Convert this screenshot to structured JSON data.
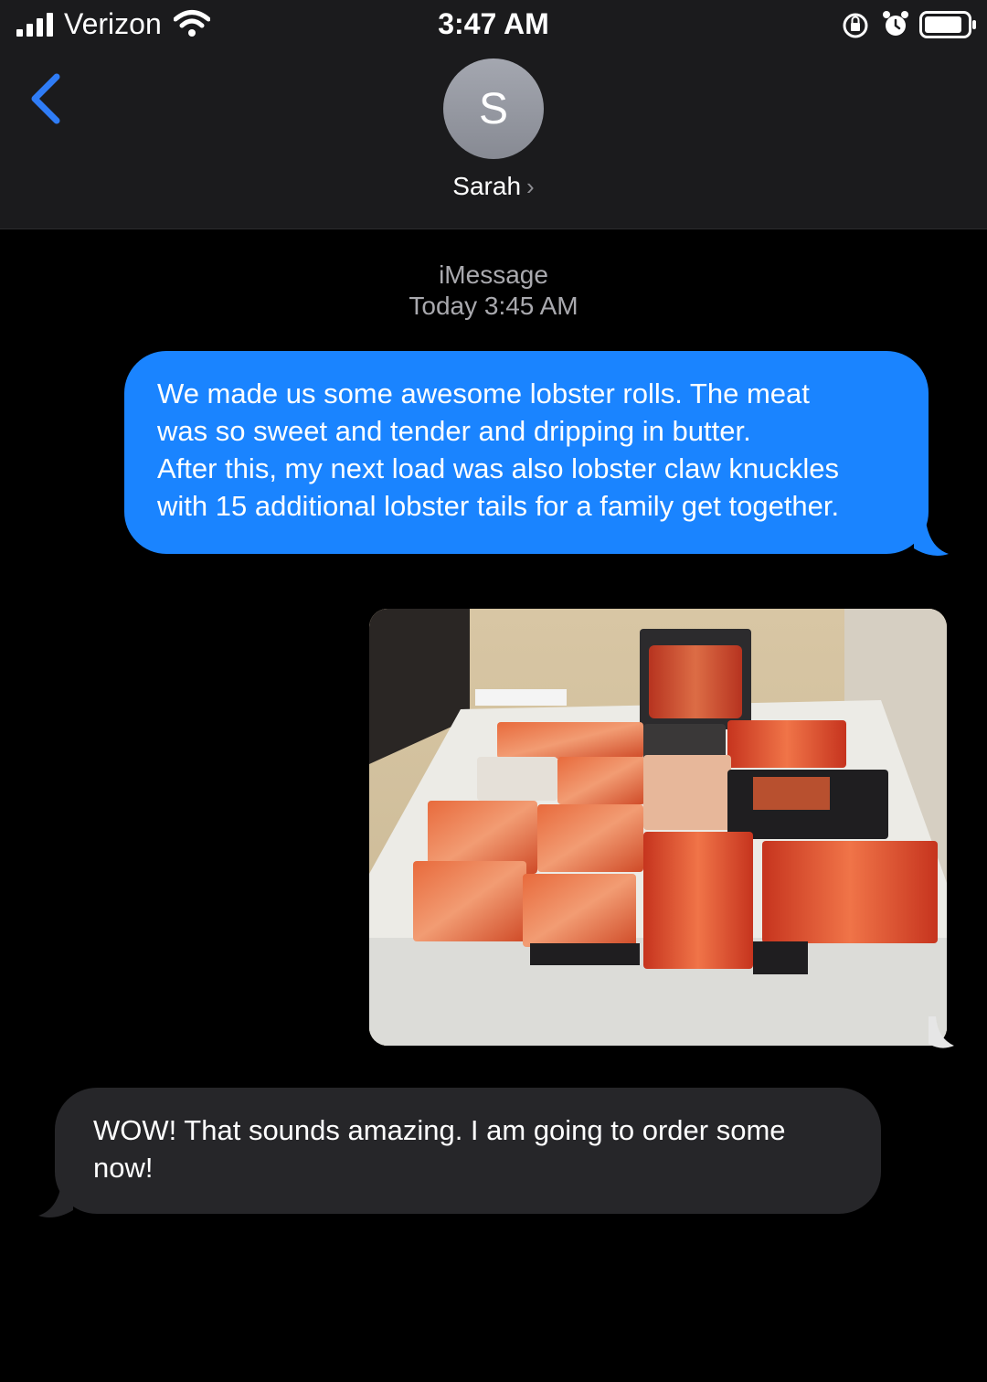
{
  "status_bar": {
    "carrier": "Verizon",
    "time": "3:47 AM"
  },
  "header": {
    "avatar_initial": "S",
    "contact_name": "Sarah",
    "chevron": "›"
  },
  "thread": {
    "service_label": "iMessage",
    "timestamp": "Today 3:45 AM"
  },
  "messages": [
    {
      "direction": "outgoing",
      "lines": [
        "We made us some awesome lobster rolls. The meat",
        "was so sweet and tender and dripping in butter.",
        "After this, my next load was also lobster claw knuckles",
        "with 15 additional lobster tails for a family get together."
      ]
    },
    {
      "direction": "outgoing",
      "attachment": "photo of packaged lobster meat on a freezer"
    },
    {
      "direction": "incoming",
      "lines": [
        "WOW! That sounds amazing. I am going to order some",
        "now!"
      ]
    }
  ],
  "colors": {
    "outgoing_bubble": "#1a84ff",
    "incoming_bubble": "#262629",
    "header_bg": "#1b1b1d",
    "back_accent": "#2f7cf6"
  }
}
